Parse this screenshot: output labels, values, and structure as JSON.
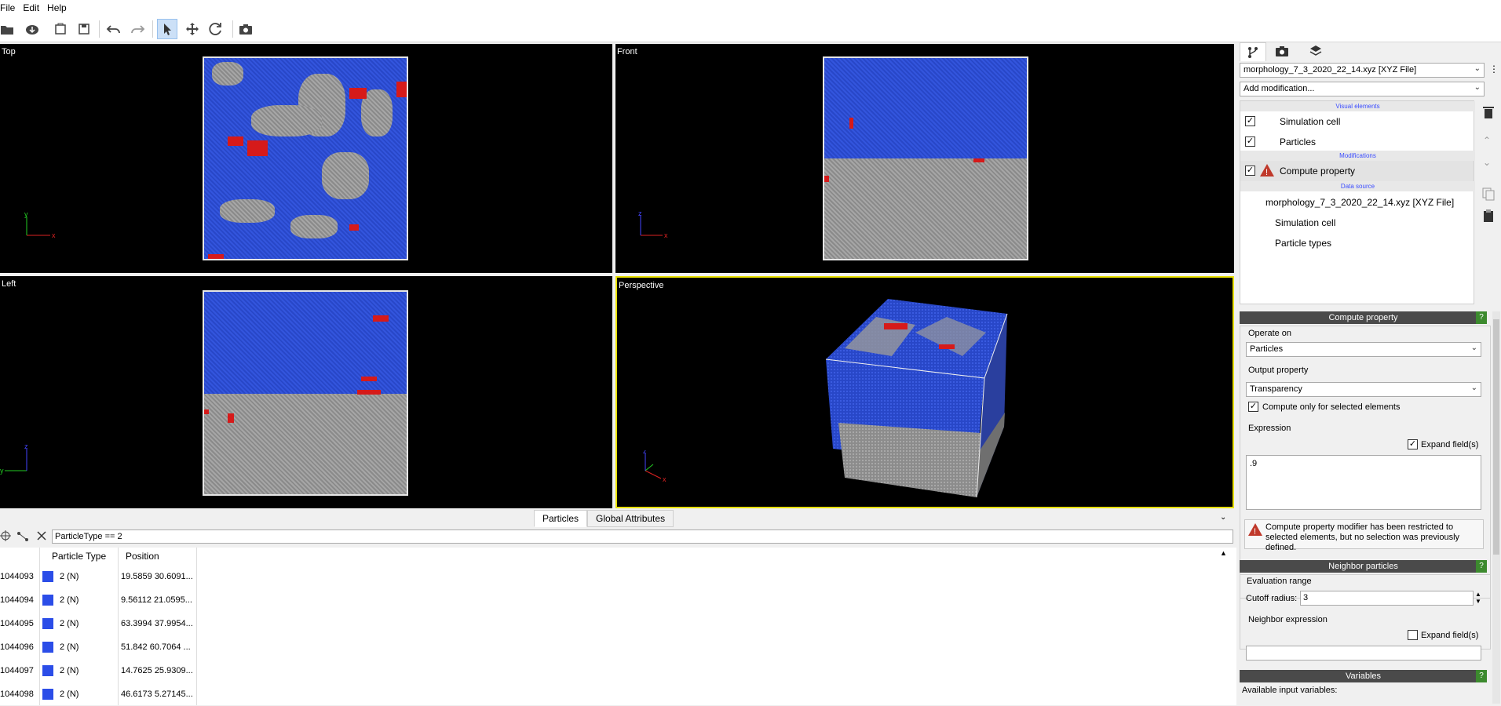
{
  "menu": [
    "File",
    "Edit",
    "Help"
  ],
  "toolbar_icons": [
    "open-file-icon",
    "download-icon",
    "load-session-icon",
    "save-session-icon",
    "undo-icon",
    "redo-icon",
    "select-mode-icon",
    "pan-mode-icon",
    "orbit-mode-icon",
    "screenshot-icon"
  ],
  "viewports": {
    "top": "Top",
    "front": "Front",
    "left": "Left",
    "perspective": "Perspective"
  },
  "axes": {
    "x": "x",
    "y": "y",
    "z": "z"
  },
  "bottom": {
    "tabs": [
      "Particles",
      "Global Attributes"
    ],
    "filter_value": "ParticleType == 2",
    "columns": [
      "Particle Type",
      "Position"
    ],
    "rows": [
      {
        "id": "1044093",
        "type": "2 (N)",
        "pos": "19.5859 30.6091..."
      },
      {
        "id": "1044094",
        "type": "2 (N)",
        "pos": "9.56112 21.0595..."
      },
      {
        "id": "1044095",
        "type": "2 (N)",
        "pos": "63.3994 37.9954..."
      },
      {
        "id": "1044096",
        "type": "2 (N)",
        "pos": "51.842 60.7064 ..."
      },
      {
        "id": "1044097",
        "type": "2 (N)",
        "pos": "14.7625 25.9309..."
      },
      {
        "id": "1044098",
        "type": "2 (N)",
        "pos": "46.6173 5.27145..."
      }
    ]
  },
  "right": {
    "file_select": "morphology_7_3_2020_22_14.xyz [XYZ File]",
    "add_modification": "Add modification...",
    "pipeline": {
      "visual_header": "Visual elements",
      "visual": [
        "Simulation cell",
        "Particles"
      ],
      "mod_header": "Modifications",
      "modifier": "Compute property",
      "source_header": "Data source",
      "source_file": "morphology_7_3_2020_22_14.xyz [XYZ File]",
      "source_items": [
        "Simulation cell",
        "Particle types"
      ]
    },
    "compute": {
      "title": "Compute property",
      "help": "?",
      "operate_on_label": "Operate on",
      "operate_on_value": "Particles",
      "output_label": "Output property",
      "output_value": "Transparency",
      "only_selected": "Compute only for selected elements",
      "expression_label": "Expression",
      "expand_fields": "Expand field(s)",
      "expression_value": ".9",
      "warning": "Compute property modifier has been restricted to selected elements, but no selection was previously defined."
    },
    "neighbor": {
      "title": "Neighbor particles",
      "help": "?",
      "eval_range": "Evaluation range",
      "cutoff_label": "Cutoff radius:",
      "cutoff_value": "3",
      "neighbor_expr": "Neighbor expression",
      "expand_fields": "Expand field(s)",
      "expr_value": ""
    },
    "variables": {
      "title": "Variables",
      "help": "?",
      "available": "Available input variables:"
    }
  }
}
